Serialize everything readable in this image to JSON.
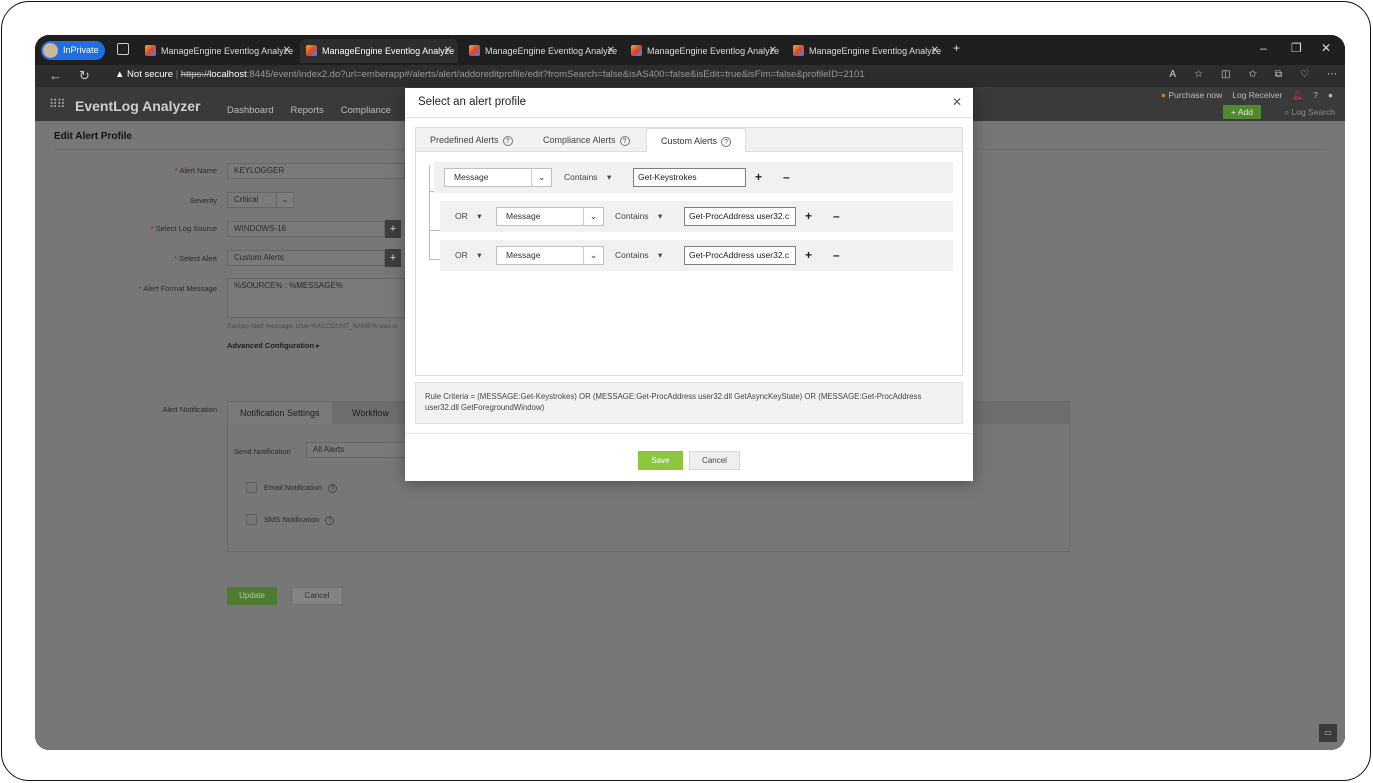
{
  "browser": {
    "inprivate_label": "InPrivate",
    "tabs": [
      {
        "title": "ManageEngine Eventlog Analyze"
      },
      {
        "title": "ManageEngine Eventlog Analyze"
      },
      {
        "title": "ManageEngine Eventlog Analyze"
      },
      {
        "title": "ManageEngine Eventlog Analyze"
      },
      {
        "title": "ManageEngine Eventlog Analyze"
      }
    ],
    "not_secure": "Not secure",
    "url_scheme": "https://",
    "url_host": "localhost",
    "url_path": ":8445/event/index2.do?url=emberapp#/alerts/alert/addoreditprofile/edit?fromSearch=false&isAS400=false&isEdit=true&isFim=false&profileID=2101"
  },
  "app": {
    "logo": "EventLog Analyzer",
    "nav": [
      "Dashboard",
      "Reports",
      "Compliance"
    ],
    "purchase": "Purchase now",
    "log_receiver": "Log Receiver",
    "add_label": "+ Add",
    "log_search": "Log Search"
  },
  "form": {
    "title": "Edit Alert Profile",
    "alert_name_label": "Alert Name",
    "alert_name_value": "KEYLOGGER",
    "severity_label": "Severity",
    "severity_value": "Critical",
    "log_source_label": "Select Log Source",
    "log_source_value": "WINDOWS-16",
    "select_alert_label": "Select Alert",
    "select_alert_value": "Custom Alerts",
    "format_label": "Alert Format Message",
    "format_value": "%SOURCE% : %MESSAGE%",
    "sample_note": "Sample Alert message: User %ACCOUNT_NAME% was cr",
    "advanced": "Advanced Configuration",
    "notification_label": "Alert Notification",
    "notif_tabs": [
      "Notification Settings",
      "Workflow"
    ],
    "send_notification_label": "Send Notification",
    "send_notification_value": "All Alerts",
    "email_notification": "Email Notification",
    "sms_notification": "SMS Notification",
    "update": "Update",
    "cancel": "Cancel"
  },
  "modal": {
    "title": "Select an alert profile",
    "tabs": [
      "Predefined Alerts",
      "Compliance Alerts",
      "Custom Alerts"
    ],
    "active_tab": "Custom Alerts",
    "rows": [
      {
        "joiner": "",
        "field": "Message",
        "operator": "Contains",
        "value": "Get-Keystrokes"
      },
      {
        "joiner": "OR",
        "field": "Message",
        "operator": "Contains",
        "value": "Get-ProcAddress user32.c"
      },
      {
        "joiner": "OR",
        "field": "Message",
        "operator": "Contains",
        "value": "Get-ProcAddress user32.c"
      }
    ],
    "criteria": "Rule Criteria = (MESSAGE:Get-Keystrokes) OR (MESSAGE:Get-ProcAddress user32.dll GetAsyncKeyState) OR (MESSAGE:Get-ProcAddress user32.dll GetForegroundWindow)",
    "save": "Save",
    "cancel": "Cancel"
  }
}
